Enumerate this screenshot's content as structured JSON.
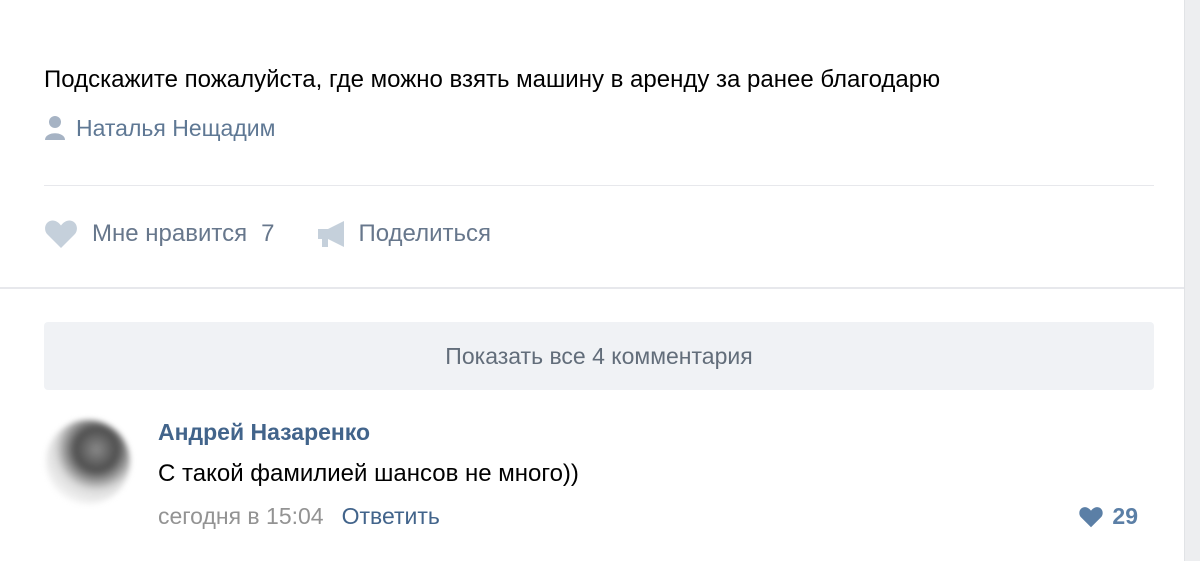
{
  "post": {
    "text": "Подскажите пожалуйста, где можно взять машину в аренду за ранее благодарю",
    "author": "Наталья Нещадим",
    "icons": {
      "author": "user-icon"
    }
  },
  "actions": {
    "like_label": "Мне нравится",
    "like_count": "7",
    "share_label": "Поделиться",
    "icons": {
      "like": "heart-icon",
      "share": "megaphone-icon"
    }
  },
  "comments": {
    "show_all_label": "Показать все 4 комментария",
    "items": [
      {
        "author": "Андрей Назаренко",
        "text": "С такой фамилией шансов не много))",
        "date": "сегодня в 15:04",
        "reply_label": "Ответить",
        "likes": "29",
        "icons": {
          "avatar": "user-avatar",
          "like": "heart-icon"
        }
      }
    ]
  },
  "colors": {
    "link": "#42648b",
    "muted": "#939393",
    "action": "#67778c",
    "liked": "#5b7fa6"
  }
}
